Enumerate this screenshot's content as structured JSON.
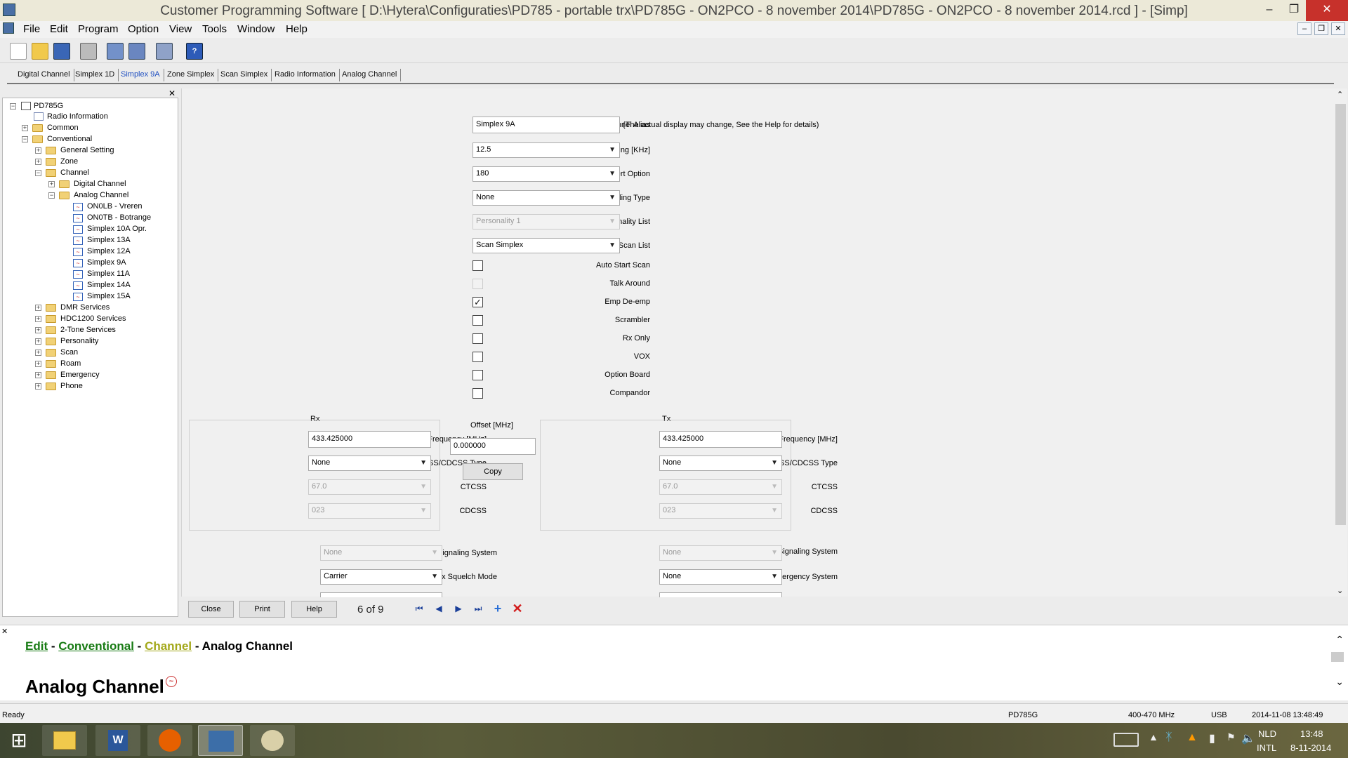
{
  "window": {
    "title": "Customer Programming Software [ D:\\Hytera\\Configuraties\\PD785 - portable trx\\PD785G - ON2PCO - 8 november 2014\\PD785G - ON2PCO - 8 november 2014.rcd ] - [Simp]",
    "min": "–",
    "max": "❐",
    "close": "✕"
  },
  "menu": [
    "File",
    "Edit",
    "Program",
    "Option",
    "View",
    "Tools",
    "Window",
    "Help"
  ],
  "mdi": {
    "min": "–",
    "restore": "❐",
    "close": "✕"
  },
  "tabs": [
    "Digital Channel",
    "Simplex 1D",
    "Simplex 9A",
    "Zone Simplex",
    "Scan Simplex",
    "Radio Information",
    "Analog Channel"
  ],
  "tree": {
    "root": "PD785G",
    "items": [
      {
        "label": "Radio Information"
      },
      {
        "label": "Common"
      },
      {
        "label": "Conventional"
      },
      {
        "label": "General Setting"
      },
      {
        "label": "Zone"
      },
      {
        "label": "Channel"
      },
      {
        "label": "Digital Channel"
      },
      {
        "label": "Analog Channel"
      },
      {
        "label": "ON0LB - Vreren"
      },
      {
        "label": "ON0TB - Botrange"
      },
      {
        "label": "Simplex 10A Opr."
      },
      {
        "label": "Simplex 13A"
      },
      {
        "label": "Simplex 12A"
      },
      {
        "label": "Simplex 9A"
      },
      {
        "label": "Simplex 11A"
      },
      {
        "label": "Simplex 14A"
      },
      {
        "label": "Simplex 15A"
      },
      {
        "label": "DMR Services"
      },
      {
        "label": "HDC1200 Services"
      },
      {
        "label": "2-Tone Services"
      },
      {
        "label": "Personality"
      },
      {
        "label": "Scan"
      },
      {
        "label": "Roam"
      },
      {
        "label": "Emergency"
      },
      {
        "label": "Phone"
      }
    ]
  },
  "form": {
    "alias_label": "Channel Alias",
    "alias_value": "Simplex 9A",
    "alias_note": "(The actual display may change, See the Help for details)",
    "spacing_label": "Channel Spacing [KHz]",
    "spacing_value": "12.5",
    "ctcss_tail_label": "CTCSS Tail Revert Option",
    "ctcss_tail_value": "180",
    "signaling_label": "Signaling Type",
    "signaling_value": "None",
    "personality_label": "Personality List",
    "personality_value": "Personality 1",
    "scanlist_label": "Scan List",
    "scanlist_value": "Scan Simplex",
    "checks": [
      {
        "label": "Auto Start Scan",
        "checked": false,
        "disabled": false
      },
      {
        "label": "Talk Around",
        "checked": false,
        "disabled": true
      },
      {
        "label": "Emp De-emp",
        "checked": true,
        "disabled": false
      },
      {
        "label": "Scrambler",
        "checked": false,
        "disabled": false
      },
      {
        "label": "Rx Only",
        "checked": false,
        "disabled": false
      },
      {
        "label": "VOX",
        "checked": false,
        "disabled": false
      },
      {
        "label": "Option Board",
        "checked": false,
        "disabled": false
      },
      {
        "label": "Compandor",
        "checked": false,
        "disabled": false
      }
    ],
    "rx": {
      "title": "Rx",
      "freq_label": "Receive Frequency [MHz]",
      "freq_value": "433.425000",
      "type_label": "Rx CTCSS/CDCSS Type",
      "type_value": "None",
      "ctcss_label": "CTCSS",
      "ctcss_value": "67.0",
      "cdcss_label": "CDCSS",
      "cdcss_value": "023"
    },
    "offset": {
      "title": "Offset [MHz]",
      "value": "0.000000",
      "copy": "Copy"
    },
    "tx": {
      "title": "Tx",
      "freq_label": "Transmit Frequency [MHz]",
      "freq_value": "433.425000",
      "type_label": "Tx CTCSS/CDCSS Type",
      "type_value": "None",
      "ctcss_label": "CTCSS",
      "ctcss_value": "67.0",
      "cdcss_label": "CDCSS",
      "cdcss_value": "023"
    },
    "rx_sig_label": "Rx Signaling System",
    "rx_sig_value": "None",
    "rx_squelch_label": "Rx Squelch Mode",
    "rx_squelch_value": "Carrier",
    "tx_sig_label": "Tx Signaling System",
    "tx_sig_value": "None",
    "emergency_label": "Emergency System",
    "emergency_value": "None"
  },
  "buttons": {
    "close": "Close",
    "print": "Print",
    "help": "Help"
  },
  "pager": "6 of 9",
  "help": {
    "crumb1": "Edit",
    "sep": "-",
    "crumb2": "Conventional",
    "crumb3": "Channel",
    "crumb4": "Analog Channel",
    "heading": "Analog Channel"
  },
  "status": {
    "ready": "Ready",
    "model": "PD785G",
    "band": "400-470 MHz",
    "port": "USB",
    "datetime": "2014-11-08 13:48:49"
  },
  "taskbar": {
    "lang": "NLD",
    "kbd": "INTL",
    "time": "13:48",
    "date": "8-11-2014"
  }
}
